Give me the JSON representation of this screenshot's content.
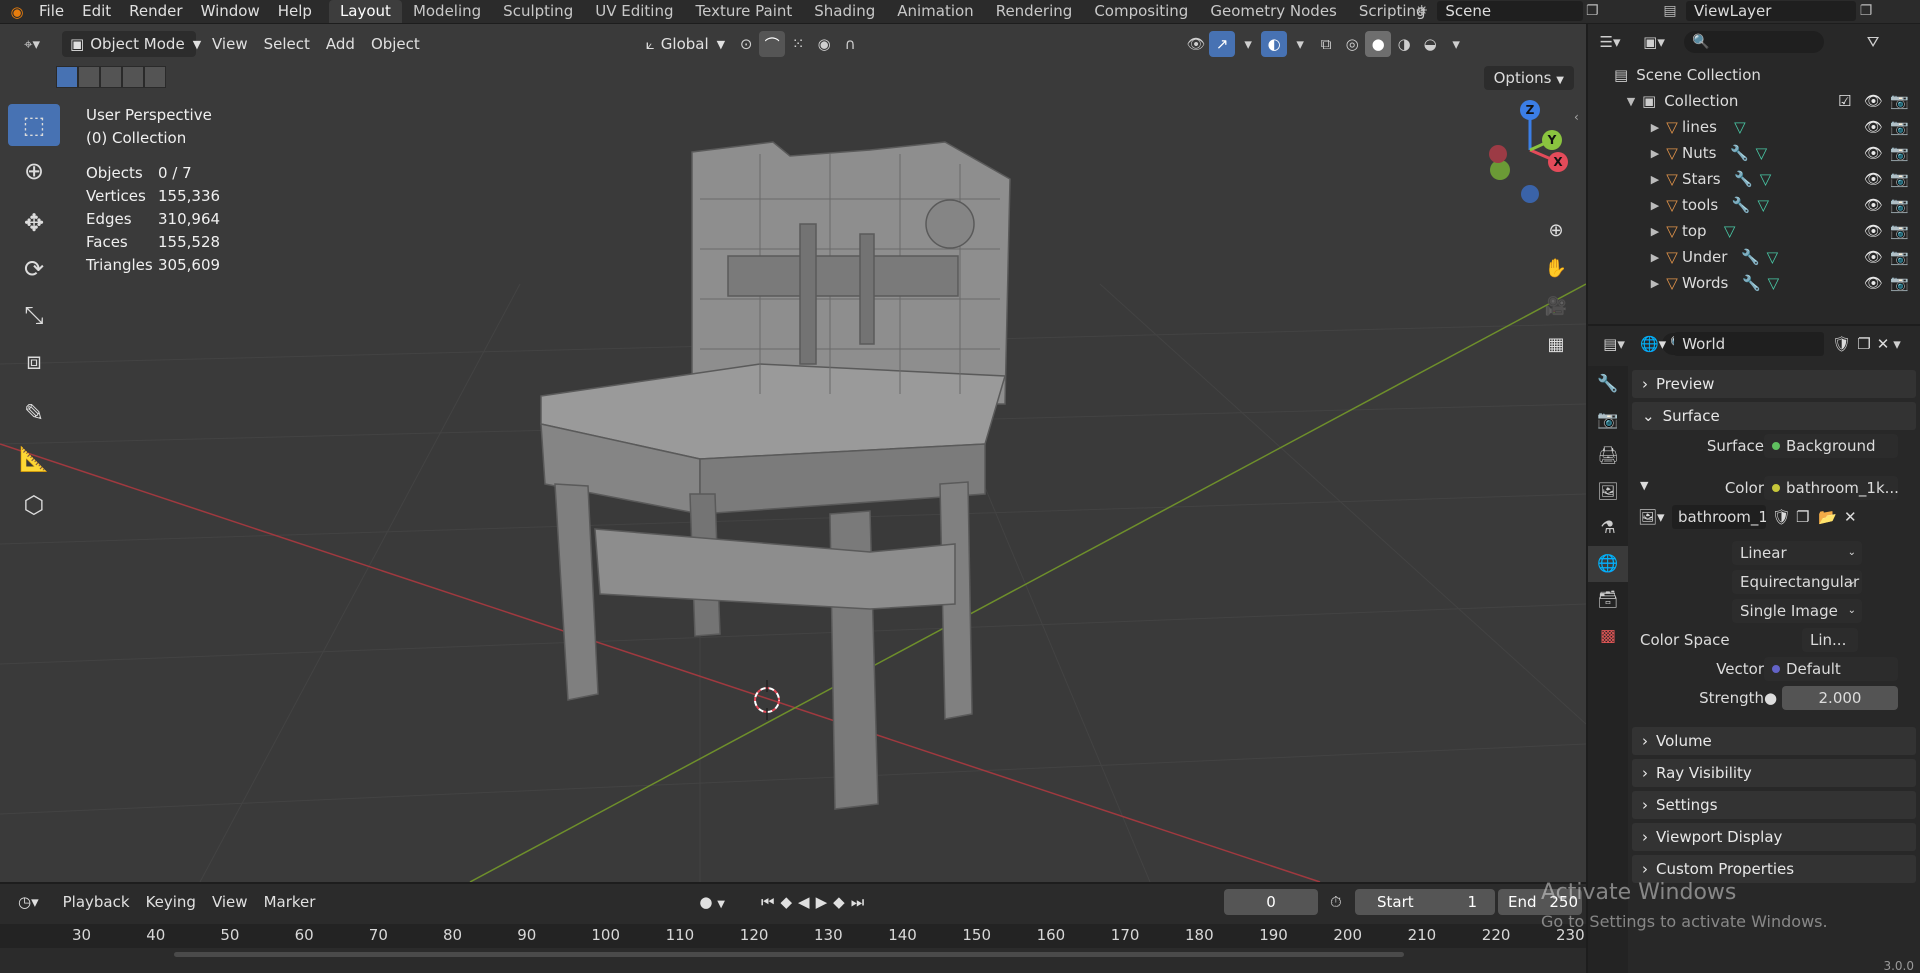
{
  "menubar": {
    "items": [
      "File",
      "Edit",
      "Render",
      "Window",
      "Help"
    ],
    "workspaces": [
      "Layout",
      "Modeling",
      "Sculpting",
      "UV Editing",
      "Texture Paint",
      "Shading",
      "Animation",
      "Rendering",
      "Compositing",
      "Geometry Nodes",
      "Scripting"
    ],
    "active_workspace": "Layout",
    "scene": "Scene",
    "view_layer": "ViewLayer"
  },
  "viewport": {
    "mode": "Object Mode",
    "menus": [
      "View",
      "Select",
      "Add",
      "Object"
    ],
    "transform_orientation": "Global",
    "options_label": "Options",
    "overlay": {
      "perspective": "User Perspective",
      "collection": "(0) Collection"
    },
    "stats": [
      {
        "label": "Objects",
        "value": "0 / 7"
      },
      {
        "label": "Vertices",
        "value": "155,336"
      },
      {
        "label": "Edges",
        "value": "310,964"
      },
      {
        "label": "Faces",
        "value": "155,528"
      },
      {
        "label": "Triangles",
        "value": "305,609"
      }
    ],
    "gizmo": {
      "x": "X",
      "y": "Y",
      "z": "Z"
    }
  },
  "timeline": {
    "menus": [
      "Playback",
      "Keying",
      "View",
      "Marker"
    ],
    "current_frame": "0",
    "start_label": "Start",
    "start": "1",
    "end_label": "End",
    "end": "250",
    "ticks": [
      "30",
      "40",
      "50",
      "60",
      "70",
      "80",
      "90",
      "100",
      "110",
      "120",
      "130",
      "140",
      "150",
      "160",
      "170",
      "180",
      "190",
      "200",
      "210",
      "220",
      "230"
    ]
  },
  "outliner": {
    "scene_collection": "Scene Collection",
    "collection": "Collection",
    "items": [
      {
        "name": "lines",
        "modifier": false
      },
      {
        "name": "Nuts",
        "modifier": true
      },
      {
        "name": "Stars",
        "modifier": true
      },
      {
        "name": "tools",
        "modifier": true
      },
      {
        "name": "top",
        "modifier": false
      },
      {
        "name": "Under",
        "modifier": true
      },
      {
        "name": "Words",
        "modifier": true
      }
    ]
  },
  "properties": {
    "world_name": "World",
    "panels": {
      "preview": "Preview",
      "surface": "Surface",
      "volume": "Volume",
      "ray_visibility": "Ray Visibility",
      "settings": "Settings",
      "viewport_display": "Viewport Display",
      "custom_properties": "Custom Properties"
    },
    "surface_label": "Surface",
    "surface_value": "Background",
    "color_label": "Color",
    "color_value": "bathroom_1k....",
    "image_name": "bathroom_1...",
    "interpolation": "Linear",
    "projection": "Equirectangular",
    "source": "Single Image",
    "color_space_label": "Color Space",
    "color_space": "Lin...",
    "vector_label": "Vector",
    "vector_value": "Default",
    "strength_label": "Strength",
    "strength_value": "2.000"
  },
  "watermark": {
    "title": "Activate Windows",
    "subtitle": "Go to Settings to activate Windows."
  },
  "version": "3.0.0",
  "colors": {
    "accent": "#4772b3",
    "axis_x": "#e44b5a",
    "axis_y": "#8ac43f",
    "axis_z": "#3b7ee6",
    "object_icon": "#e0934a",
    "mesh_icon": "#49c7a5"
  }
}
